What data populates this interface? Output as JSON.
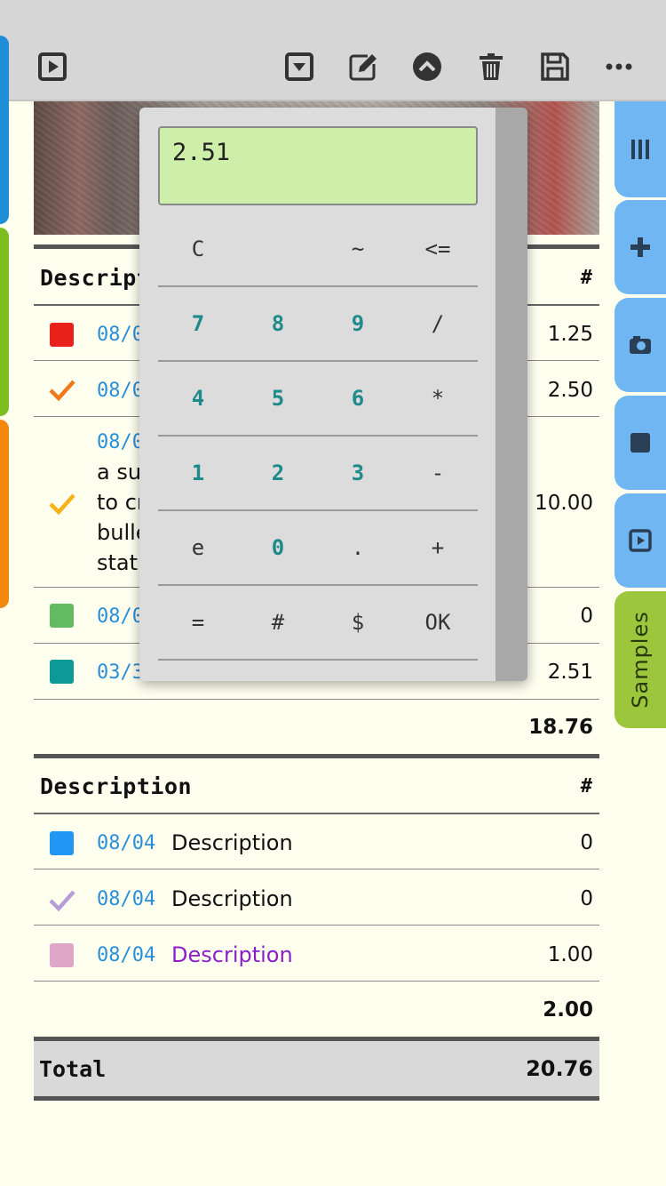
{
  "toolbar": {
    "icons": [
      "play-icon",
      "dropdown-icon",
      "edit-icon",
      "chevron-up-icon",
      "trash-icon",
      "save-icon",
      "more-icon"
    ]
  },
  "side_tabs": {
    "samples_label": "Samples"
  },
  "table1": {
    "header_desc": "Descript",
    "header_num": "#",
    "rows": [
      {
        "date": "08/0",
        "amount": "1.25",
        "marker": "#e8221b"
      },
      {
        "date": "08/0",
        "amount": "2.50",
        "marker": "#f07a1a"
      },
      {
        "date": "08/0",
        "lines": [
          "a su",
          "to cr",
          "bulle",
          "stat"
        ],
        "amount": "10.00",
        "marker": "#f6b21a"
      },
      {
        "date": "08/0",
        "amount": "0",
        "marker": "#62bb63"
      },
      {
        "date": "03/3",
        "amount": "2.51",
        "marker": "#0d9a97"
      }
    ],
    "subtotal": "18.76"
  },
  "table2": {
    "header_desc": "Description",
    "header_num": "#",
    "rows": [
      {
        "date": "08/04",
        "desc": "Description",
        "amount": "0",
        "marker": "#2196f3"
      },
      {
        "date": "08/04",
        "desc": "Description",
        "amount": "0",
        "marker": "#b79ed8"
      },
      {
        "date": "08/04",
        "desc": "Description",
        "amount": "1.00",
        "marker": "#dfa6c8",
        "desc_color": "#8a1fc7"
      }
    ],
    "subtotal": "2.00"
  },
  "total": {
    "label": "Total",
    "value": "20.76"
  },
  "calculator": {
    "display": "2.51",
    "rows": [
      [
        "C",
        "",
        "~",
        "<="
      ],
      [
        "7",
        "8",
        "9",
        "/"
      ],
      [
        "4",
        "5",
        "6",
        "*"
      ],
      [
        "1",
        "2",
        "3",
        "-"
      ],
      [
        "e",
        "0",
        ".",
        "+"
      ],
      [
        "=",
        "#",
        "$",
        "OK"
      ]
    ]
  }
}
